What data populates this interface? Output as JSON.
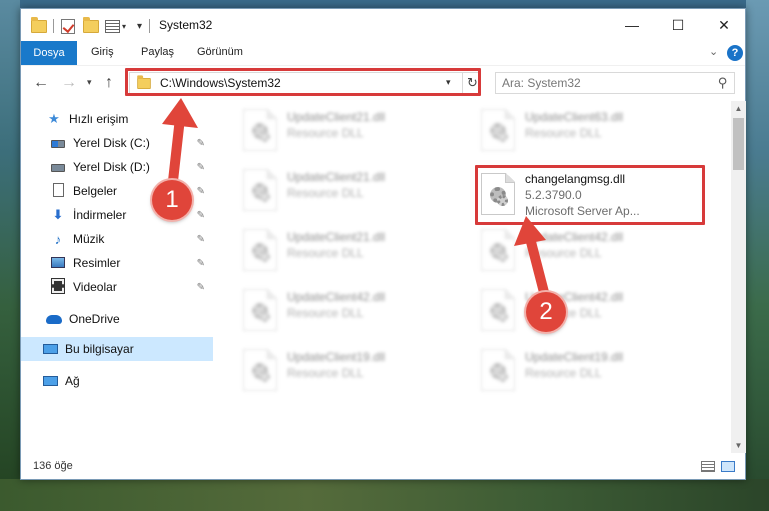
{
  "window": {
    "title": "System32",
    "controls": {
      "minimize": "—",
      "maximize": "☐",
      "close": "✕"
    }
  },
  "ribbon": {
    "tabs": [
      "Dosya",
      "Giriş",
      "Paylaş",
      "Görünüm"
    ],
    "help": "?"
  },
  "address": {
    "path": "C:\\Windows\\System32",
    "search_placeholder": "Ara: System32"
  },
  "navpane": {
    "items": [
      {
        "label": "Hızlı erişim",
        "icon": "star-icon"
      },
      {
        "label": "Yerel Disk (C:)",
        "icon": "drive-icon",
        "pinned": true
      },
      {
        "label": "Yerel Disk (D:)",
        "icon": "drive-icon",
        "pinned": true
      },
      {
        "label": "Belgeler",
        "icon": "document-icon",
        "pinned": true
      },
      {
        "label": "İndirmeler",
        "icon": "download-icon",
        "pinned": true
      },
      {
        "label": "Müzik",
        "icon": "music-icon",
        "pinned": true
      },
      {
        "label": "Resimler",
        "icon": "pictures-icon",
        "pinned": true
      },
      {
        "label": "Videolar",
        "icon": "videos-icon",
        "pinned": true
      },
      {
        "label": "OneDrive",
        "icon": "cloud-icon"
      },
      {
        "label": "Bu bilgisayar",
        "icon": "computer-icon",
        "selected": true
      },
      {
        "label": "Ağ",
        "icon": "network-icon"
      }
    ]
  },
  "files": [
    {
      "name": "UpdateClient21.dll",
      "desc": "Resource DLL",
      "blurred": true
    },
    {
      "name": "UpdateClient63.dll",
      "desc": "Resource DLL",
      "blurred": true
    },
    {
      "name": "UpdateClient21.dll",
      "desc": "Resource DLL",
      "blurred": true
    },
    {
      "name": "changelangmsg.dll",
      "version": "5.2.3790.0",
      "desc": "Microsoft Server Ap...",
      "blurred": false
    },
    {
      "name": "UpdateClient21.dll",
      "desc": "Resource DLL",
      "blurred": true
    },
    {
      "name": "UpdateClient42.dll",
      "desc": "Resource DLL",
      "blurred": true
    },
    {
      "name": "UpdateClient42.dll",
      "desc": "Resource DLL",
      "blurred": true
    },
    {
      "name": "UpdateClient42.dll",
      "desc": "Resource DLL",
      "blurred": true
    },
    {
      "name": "UpdateClient19.dll",
      "desc": "Resource DLL",
      "blurred": true
    },
    {
      "name": "UpdateClient19.dll",
      "desc": "Resource DLL",
      "blurred": true
    }
  ],
  "status": {
    "count": "136 öğe"
  },
  "annotations": {
    "badge1": "1",
    "badge2": "2",
    "color": "#d73a3a"
  }
}
